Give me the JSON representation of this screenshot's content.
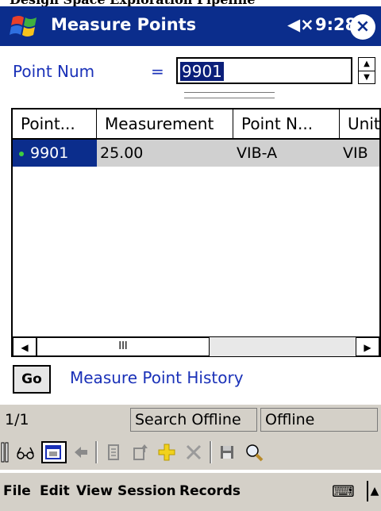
{
  "top_strip_text": "Design Space Exploration Pipeline",
  "titlebar": {
    "title": "Measure Points",
    "volume_icon": "◀×",
    "time": "9:28",
    "close_glyph": "×"
  },
  "form": {
    "point_num_label": "Point Num",
    "equals": "=",
    "point_num_value": "9901",
    "spin_up": "▲",
    "spin_down": "▼"
  },
  "grid": {
    "columns": [
      "Point...",
      "Measurement",
      "Point N...",
      "Unit"
    ],
    "rows": [
      {
        "point": "9901",
        "measurement": "25.00",
        "point_name": "VIB-A",
        "unit": "VIB"
      }
    ],
    "scroll_left": "◀",
    "scroll_thumb": "III",
    "scroll_right": "▶"
  },
  "go_button": "Go",
  "history_link": "Measure Point History",
  "status": {
    "page": "1/1",
    "search_mode": "Search Offline",
    "connection": "Offline"
  },
  "toolbar_icons": [
    "drag-handle-icon",
    "glasses-icon",
    "calendar-icon",
    "back-arrow-icon",
    "copy-icon",
    "upload-icon",
    "add-icon",
    "delete-icon",
    "save-icon",
    "search-icon"
  ],
  "menu": [
    "File",
    "Edit",
    "View",
    "Session",
    "Records"
  ],
  "keyboard_icon": "⌨",
  "sip_caret": "▲",
  "colors": {
    "titlebar": "#0b2d8c",
    "link": "#1a31b8",
    "selection": "#0b2d8c",
    "chrome": "#d4d0c8"
  }
}
